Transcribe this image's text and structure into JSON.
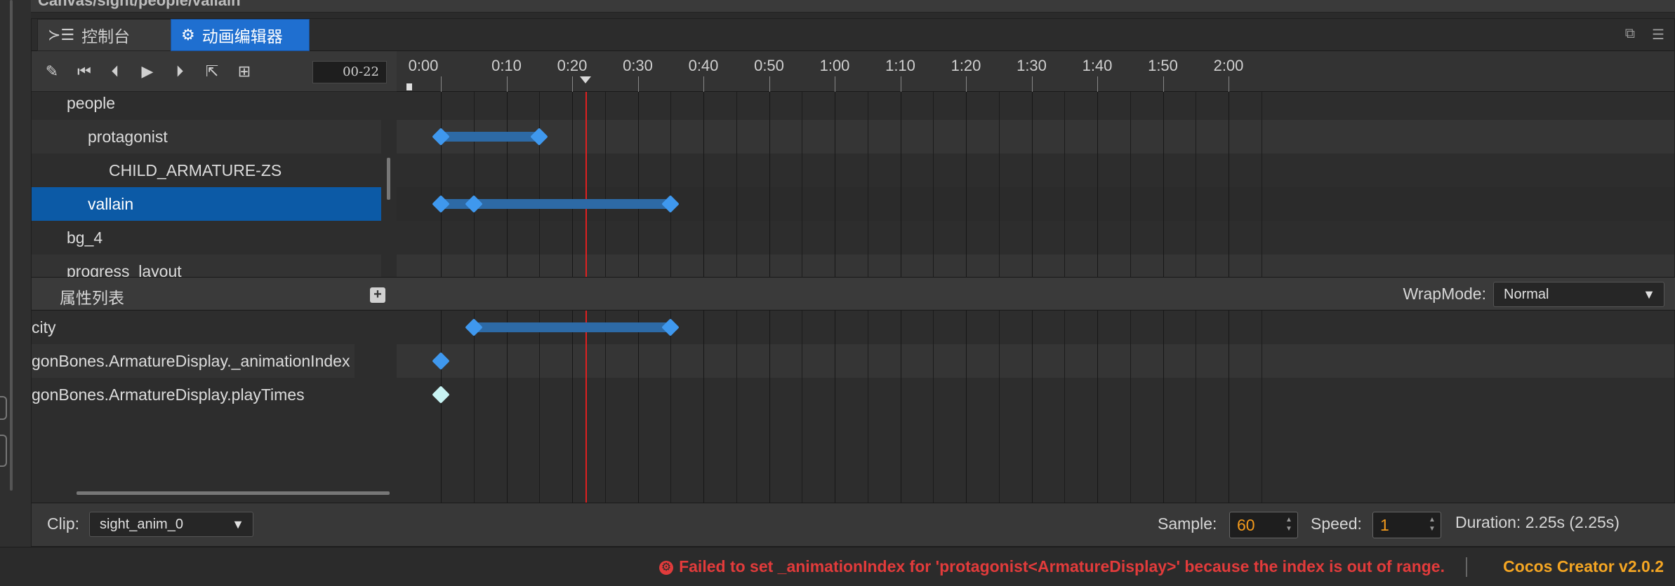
{
  "path_bar": {
    "text": "Canvas/sight/people/vallain"
  },
  "tabs": [
    {
      "label": "控制台",
      "icon": "console-icon"
    },
    {
      "label": "动画编辑器",
      "icon": "animation-editor-icon"
    }
  ],
  "toolbar": {
    "buttons": [
      "edit-icon",
      "jump-to-start-icon",
      "step-back-icon",
      "play-icon",
      "step-forward-icon",
      "export-icon",
      "add-event-icon"
    ],
    "timecode": "00-22"
  },
  "ruler": {
    "labels": [
      "0:00",
      "0:10",
      "0:20",
      "0:30",
      "0:40",
      "0:50",
      "1:00",
      "1:10",
      "1:20",
      "1:30",
      "1:40",
      "1:50",
      "2:00"
    ],
    "current_frame": 22
  },
  "tree": {
    "nodes": [
      {
        "label": "people",
        "depth": 0
      },
      {
        "label": "protagonist",
        "depth": 1
      },
      {
        "label": "CHILD_ARMATURE-ZS",
        "depth": 2
      },
      {
        "label": "vallain",
        "depth": 1,
        "selected": true
      },
      {
        "label": "bg_4",
        "depth": 0
      },
      {
        "label": "progress_layout",
        "depth": 0
      }
    ]
  },
  "node_tracks": [
    {
      "keyframes": [],
      "span": null
    },
    {
      "keyframes": [
        0,
        15
      ],
      "span": [
        0,
        15
      ]
    },
    {
      "keyframes": [],
      "span": null
    },
    {
      "keyframes": [
        0,
        5,
        35
      ],
      "span": [
        0,
        35
      ]
    },
    {
      "keyframes": [],
      "span": null
    },
    {
      "keyframes": [],
      "span": null
    }
  ],
  "properties": {
    "title": "属性列表",
    "wrap_label": "WrapMode:",
    "wrap_value": "Normal",
    "items": [
      {
        "label": "city",
        "keyframes": [
          5,
          35
        ],
        "span": [
          5,
          35
        ],
        "style": "normal"
      },
      {
        "label": "gonBones.ArmatureDisplay._animationIndex",
        "keyframes": [
          0
        ],
        "span": null,
        "style": "normal"
      },
      {
        "label": "gonBones.ArmatureDisplay.playTimes",
        "keyframes": [
          0
        ],
        "span": null,
        "style": "light"
      }
    ]
  },
  "bottom": {
    "clip_label": "Clip:",
    "clip_value": "sight_anim_0",
    "sample_label": "Sample:",
    "sample_value": "60",
    "speed_label": "Speed:",
    "speed_value": "1",
    "duration": "Duration: 2.25s (2.25s)"
  },
  "status": {
    "error": "Failed to set _animationIndex for 'protagonist<ArmatureDisplay>' because the index is out of range.",
    "version": "Cocos Creator v2.0.2"
  },
  "colors": {
    "keyframe": "#3f98ee",
    "keyframe_light": "#c8f3f3",
    "span": "#2d6aa6",
    "selection": "#0c5aa6",
    "playhead": "#e02020",
    "error": "#e23b3b",
    "version": "#f5a623"
  }
}
